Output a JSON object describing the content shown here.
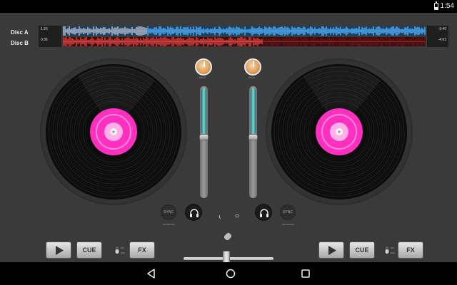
{
  "status_bar": {
    "time": "1:54"
  },
  "waveform": {
    "disc_a_label": "Disc A",
    "disc_b_label": "Disc B",
    "disc_a_time": "1:26",
    "disc_b_time": "0:36",
    "disc_a_remaining": "-3:40",
    "disc_b_remaining": "-4:03",
    "disc_a_progress": 0.23,
    "disc_b_progress": 0.55,
    "color_a_played": "#8a9bb0",
    "color_a_unplayed": "#3d8fd0",
    "color_b_played": "#b03030",
    "color_b_unplayed": "#5a1010"
  },
  "decks": {
    "label_color": "#ff2fc0",
    "a": {
      "pitch_label": "PITCH",
      "volume_level": 0.55,
      "sync_label": "SYNC",
      "autosync_label": "AUTOSYNC",
      "cue_label": "CUE",
      "fx_label": "FX",
      "toggle_top": "ON",
      "toggle_bottom": "OFF"
    },
    "b": {
      "pitch_label": "PITCH",
      "volume_level": 0.55,
      "sync_label": "SYNC",
      "autosync_label": "AUTOSYNC",
      "cue_label": "CUE",
      "fx_label": "FX",
      "toggle_top": "ON",
      "toggle_bottom": "OFF"
    }
  },
  "crossfader": {
    "position": 0.48
  },
  "accent_color": "#6ee0e0"
}
